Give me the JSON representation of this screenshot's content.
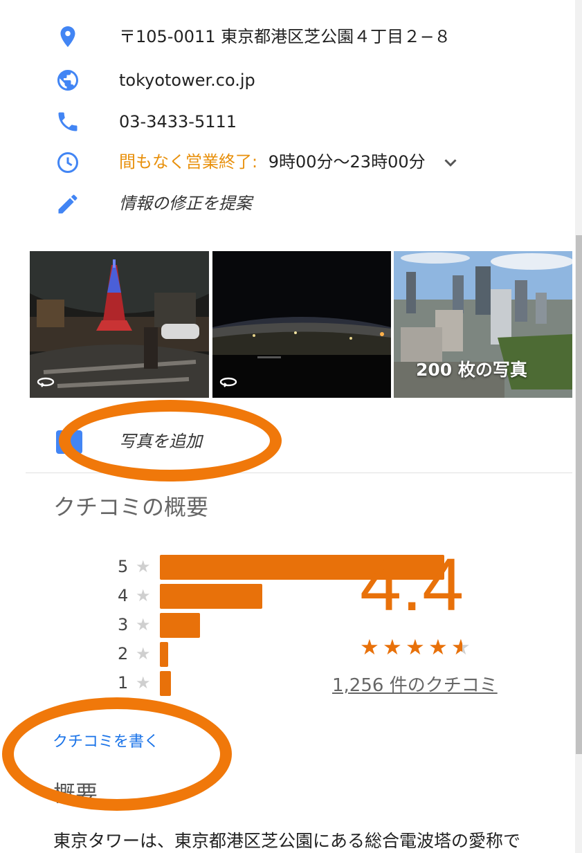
{
  "info": {
    "address": "〒105-0011 東京都港区芝公園４丁目２−８",
    "website": "tokyotower.co.jp",
    "phone": "03-3433-5111",
    "hours_status": "間もなく営業終了:",
    "hours_time": "9時00分〜23時00分",
    "suggest_edit": "情報の修正を提案"
  },
  "photos": {
    "count_label": "200 枚の写真",
    "add_photo_label": "写真を追加"
  },
  "reviews": {
    "section_title": "クチコミの概要",
    "average": "4.4",
    "average_value": 4.4,
    "review_count_label": "1,256 件のクチコミ",
    "write_review_label": "クチコミを書く",
    "star_glyph": "★",
    "distribution": [
      {
        "stars": "5",
        "fraction": 1.0
      },
      {
        "stars": "4",
        "fraction": 0.36
      },
      {
        "stars": "3",
        "fraction": 0.14
      },
      {
        "stars": "2",
        "fraction": 0.03
      },
      {
        "stars": "1",
        "fraction": 0.04
      }
    ]
  },
  "overview": {
    "section_title": "概要",
    "description": "東京タワーは、東京都港区芝公園にある総合電波塔の愛称で"
  },
  "colors": {
    "accent_orange": "#e8710a",
    "hours_orange": "#e8900c",
    "icon_blue": "#4285f4",
    "link_blue": "#1a73e8",
    "annotation_orange": "#f0780a"
  },
  "icons": [
    "location-pin-icon",
    "globe-icon",
    "phone-icon",
    "clock-icon",
    "pencil-icon",
    "chevron-down-icon",
    "photo-360-icon",
    "add-photo-icon",
    "star-icon"
  ]
}
